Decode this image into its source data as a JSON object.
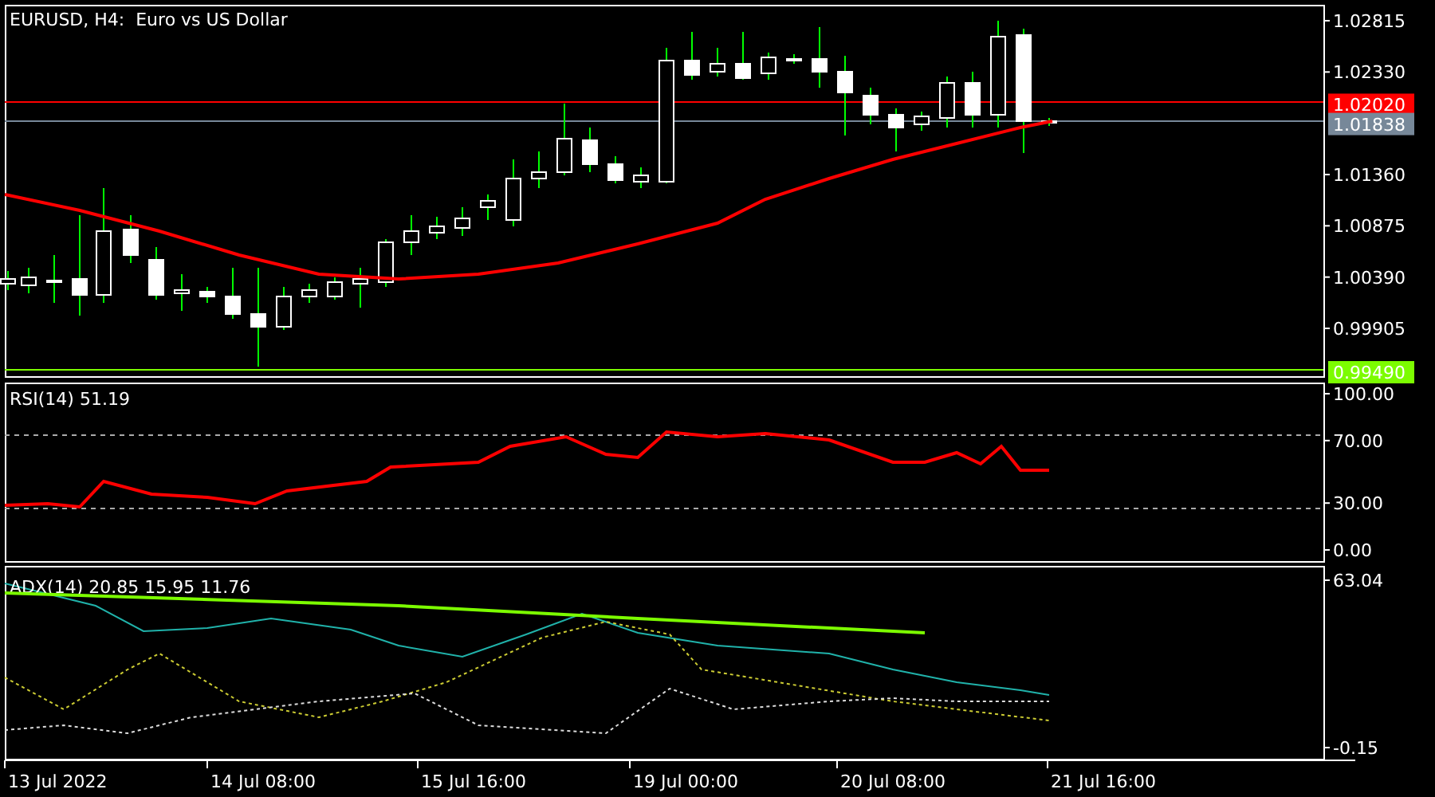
{
  "chart": {
    "title": "EURUSD, H4:  Euro vs US Dollar",
    "price_axis": [
      "1.02815",
      "1.02330",
      "1.01360",
      "1.00875",
      "1.00390",
      "0.99905"
    ],
    "price_tags": [
      {
        "label": "1.02020",
        "color": "#ff0000"
      },
      {
        "label": "1.01838",
        "color": "#778899"
      },
      {
        "label": "0.99490",
        "color": "#7cfc00"
      }
    ]
  },
  "rsi": {
    "label": "RSI(14) 51.19",
    "axis": [
      "100.00",
      "70.00",
      "30.00",
      "0.00"
    ]
  },
  "adx": {
    "label": "ADX(14) 20.85 15.95 11.76",
    "axis": [
      "63.04",
      "-0.15"
    ]
  },
  "time_axis": [
    "13 Jul 2022",
    "14 Jul 08:00",
    "15 Jul 16:00",
    "19 Jul 00:00",
    "20 Jul 08:00",
    "21 Jul 16:00"
  ]
}
